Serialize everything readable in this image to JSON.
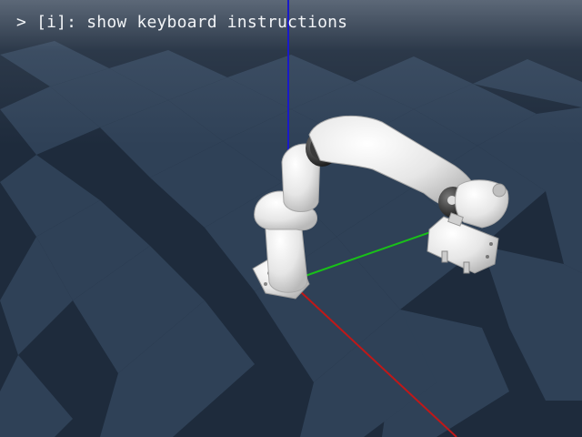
{
  "overlay": {
    "hint_text": "> [i]: show keyboard instructions"
  },
  "scene": {
    "floor_color_dark": "#1e2b3c",
    "floor_color_light": "#2f4157",
    "axes": {
      "x_color": "#c01818",
      "y_color": "#19c019",
      "z_color": "#1a1ac8"
    },
    "robot_color": "#eeeeee"
  }
}
